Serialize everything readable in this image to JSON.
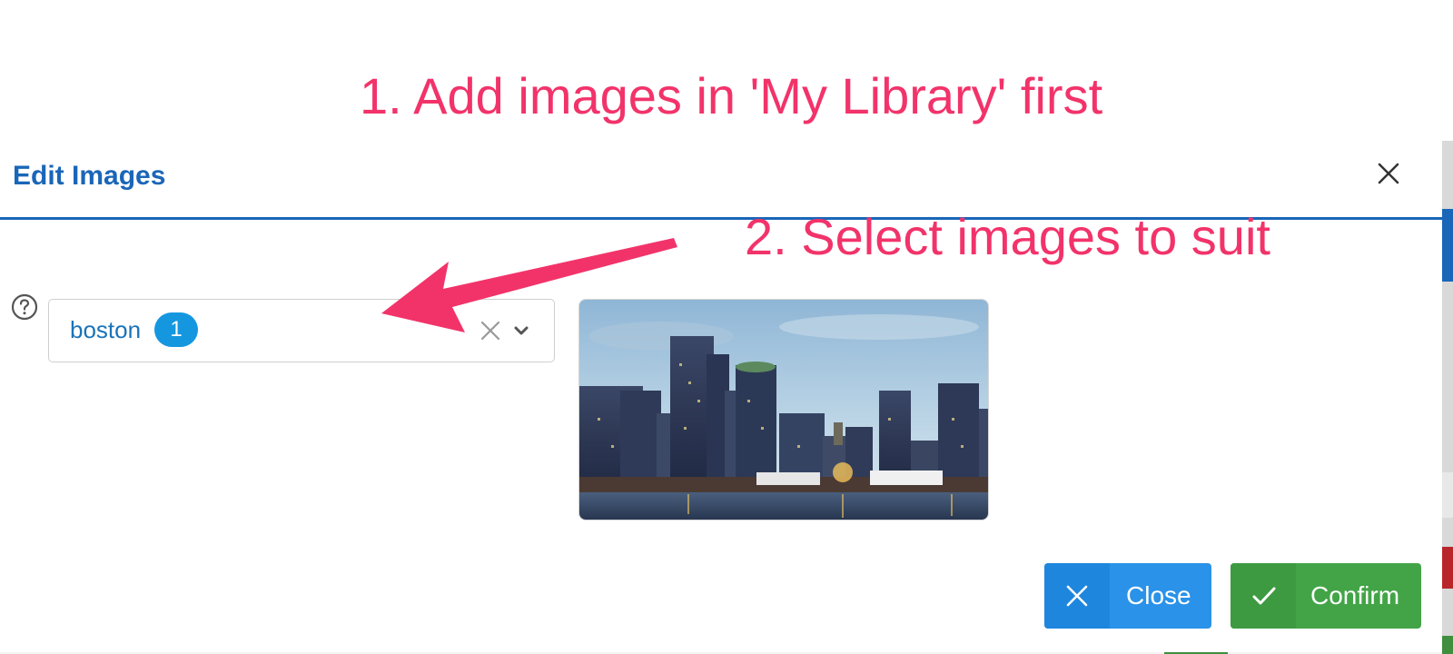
{
  "annotations": {
    "step1": "1. Add images in 'My Library' first",
    "step2": "2. Select images to suit",
    "color": "#f2336a"
  },
  "modal": {
    "title": "Edit Images",
    "close_icon": "close-icon",
    "help_icon": "question-circle-icon",
    "select": {
      "value": "boston",
      "badge_count": "1",
      "clear_icon": "clear-icon",
      "caret_icon": "chevron-down-icon"
    },
    "image": {
      "subject": "Boston skyline at dusk"
    },
    "buttons": {
      "close_label": "Close",
      "close_icon": "close-icon",
      "confirm_label": "Confirm",
      "confirm_icon": "checkmark-icon"
    }
  },
  "colors": {
    "accent": "#1a66b8",
    "badge": "#1597e0",
    "close_button": "#2a92e8",
    "confirm_button": "#43a447"
  }
}
